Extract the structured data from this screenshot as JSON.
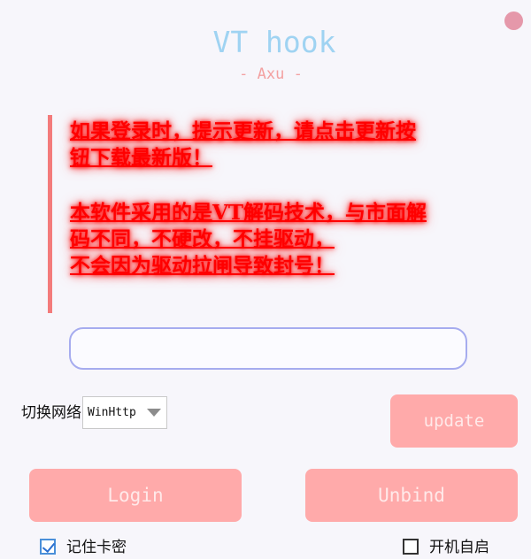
{
  "window": {
    "title": "VT hook",
    "subtitle": "- Axu -",
    "close_color": "#e598aa"
  },
  "notice": {
    "paragraph_1": "如果登录时，提示更新，请点击更新按\n钮下载最新版！",
    "paragraph_2": "本软件采用的是VT解码技术，与市面解\n码不同，不硬改，不挂驱动，\n不会因为驱动拉闸导致封号！",
    "text_color": "#ff0000",
    "bar_color": "#f37b7b"
  },
  "key_input": {
    "value": "",
    "placeholder": ""
  },
  "network": {
    "label": "切换网络",
    "selected": "WinHttp"
  },
  "buttons": {
    "update": "update",
    "login": "Login",
    "unbind": "Unbind",
    "color": "#ffaaaa"
  },
  "options": {
    "remember_label": "记住卡密",
    "remember_checked": true,
    "autostart_label": "开机自启",
    "autostart_checked": false
  }
}
